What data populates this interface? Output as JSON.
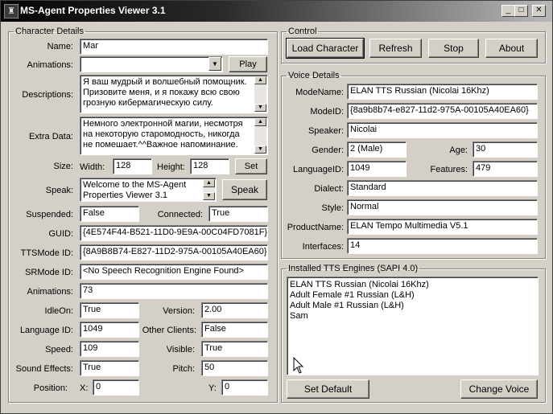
{
  "window": {
    "title": "MS-Agent Properties Viewer 3.1"
  },
  "character": {
    "legend": "Character Details",
    "name_label": "Name:",
    "name_value": "Маг",
    "animations_label": "Animations:",
    "animations_value": "",
    "play_label": "Play",
    "descriptions_label": "Descriptions:",
    "descriptions_value": "Я ваш мудрый и волшебный помощник. Призовите меня, и я покажу всю свою грозную кибермагическую силу.",
    "extra_label": "Extra Data:",
    "extra_value": "Немного электронной магии, несмотря на некоторую старомодность, никогда не помешает.^^Важное напоминание.",
    "size_label": "Size:",
    "width_label": "Width:",
    "width_value": "128",
    "height_label": "Height:",
    "height_value": "128",
    "set_label": "Set",
    "speak_label": "Speak:",
    "speak_value": "Welcome to the MS-Agent Properties Viewer 3.1",
    "speak_button": "Speak",
    "suspended_label": "Suspended:",
    "suspended_value": "False",
    "connected_label": "Connected:",
    "connected_value": "True",
    "guid_label": "GUID:",
    "guid_value": "{4E574F44-B521-11D0-9E9A-00C04FD7081F}",
    "ttsmode_label": "TTSMode ID:",
    "ttsmode_value": "{8A9B8B74-E827-11D2-975A-00105A40EA60}",
    "srmode_label": "SRMode ID:",
    "srmode_value": "<No Speech Recognition Engine Found>",
    "anim_count_label": "Animations:",
    "anim_count_value": "73",
    "idleon_label": "IdleOn:",
    "idleon_value": "True",
    "version_label": "Version:",
    "version_value": "2.00",
    "langid_label": "Language ID:",
    "langid_value": "1049",
    "other_clients_label": "Other Clients:",
    "other_clients_value": "False",
    "speed_label": "Speed:",
    "speed_value": "109",
    "visible_label": "Visible:",
    "visible_value": "True",
    "sound_label": "Sound Effects:",
    "sound_value": "True",
    "pitch_label": "Pitch:",
    "pitch_value": "50",
    "position_label": "Position:",
    "x_label": "X:",
    "x_value": "0",
    "y_label": "Y:",
    "y_value": "0"
  },
  "control": {
    "legend": "Control",
    "load_label": "Load Character",
    "refresh_label": "Refresh",
    "stop_label": "Stop",
    "about_label": "About"
  },
  "voice": {
    "legend": "Voice Details",
    "modename_label": "ModeName:",
    "modename_value": "ELAN TTS Russian (Nicolai 16Khz)",
    "modeid_label": "ModeID:",
    "modeid_value": "{8a9b8b74-e827-11d2-975A-00105A40EA60}",
    "speaker_label": "Speaker:",
    "speaker_value": "Nicolai",
    "gender_label": "Gender:",
    "gender_value": "2 (Male)",
    "age_label": "Age:",
    "age_value": "30",
    "languageid_label": "LanguageID:",
    "languageid_value": "1049",
    "features_label": "Features:",
    "features_value": "479",
    "dialect_label": "Dialect:",
    "dialect_value": "Standard",
    "style_label": "Style:",
    "style_value": "Normal",
    "product_label": "ProductName:",
    "product_value": "ELAN Tempo Multimedia V5.1",
    "interfaces_label": "Interfaces:",
    "interfaces_value": "14"
  },
  "tts": {
    "legend": "Installed TTS Engines (SAPI 4.0)",
    "engines": [
      "ELAN TTS Russian (Nicolai 16Khz)",
      "Adult Female #1 Russian (L&H)",
      "Adult Male #1 Russian (L&H)",
      "Sam"
    ],
    "set_default_label": "Set Default",
    "change_voice_label": "Change Voice"
  }
}
